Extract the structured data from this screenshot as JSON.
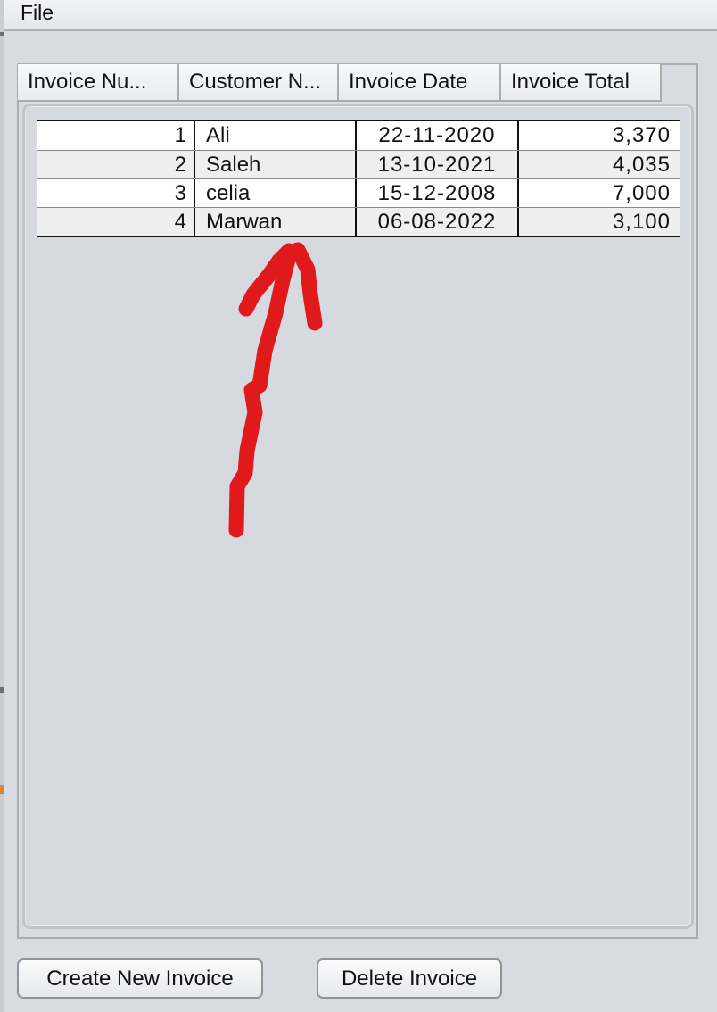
{
  "menu": {
    "file_label": "File"
  },
  "table": {
    "columns": [
      "Invoice Nu...",
      "Customer N...",
      "Invoice Date",
      "Invoice Total"
    ],
    "rows": [
      [
        "1",
        "Ali",
        "22-11-2020",
        "3,370"
      ],
      [
        "2",
        "Saleh",
        "13-10-2021",
        "4,035"
      ],
      [
        "3",
        "celia",
        "15-12-2008",
        "7,000"
      ],
      [
        "4",
        "Marwan",
        "06-08-2022",
        "3,100"
      ]
    ]
  },
  "buttons": {
    "create_label": "Create New Invoice",
    "delete_label": "Delete Invoice"
  },
  "annotation": {
    "color": "#e0191b",
    "shape": "arrow-up"
  },
  "colors": {
    "background": "#d8dbe2",
    "row_even": "#efefef",
    "row_odd": "#ffffff"
  }
}
